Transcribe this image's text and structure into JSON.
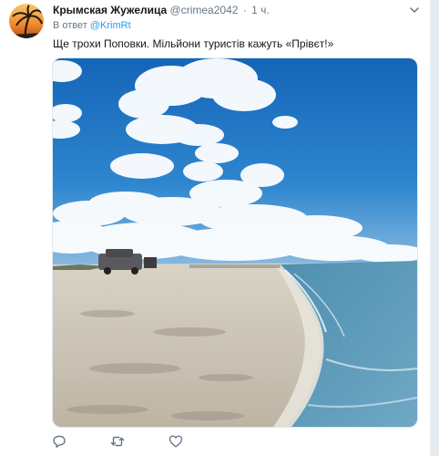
{
  "tweet": {
    "author": {
      "display_name": "Крымская Жужелица",
      "handle": "@crimea2042"
    },
    "separator": "·",
    "time": "1 ч.",
    "reply_prefix": "В ответ",
    "reply_to": "@KrimRt",
    "text": "Ще трохи Поповки. Мільйони туристів кажуть «Прівєт!»"
  },
  "icons": {
    "caret": "chevron-down-icon",
    "reply": "reply-icon",
    "retweet": "retweet-icon",
    "like": "heart-icon"
  },
  "colors": {
    "accent": "#1da1f2",
    "text": "#14171a",
    "secondary": "#657786"
  }
}
